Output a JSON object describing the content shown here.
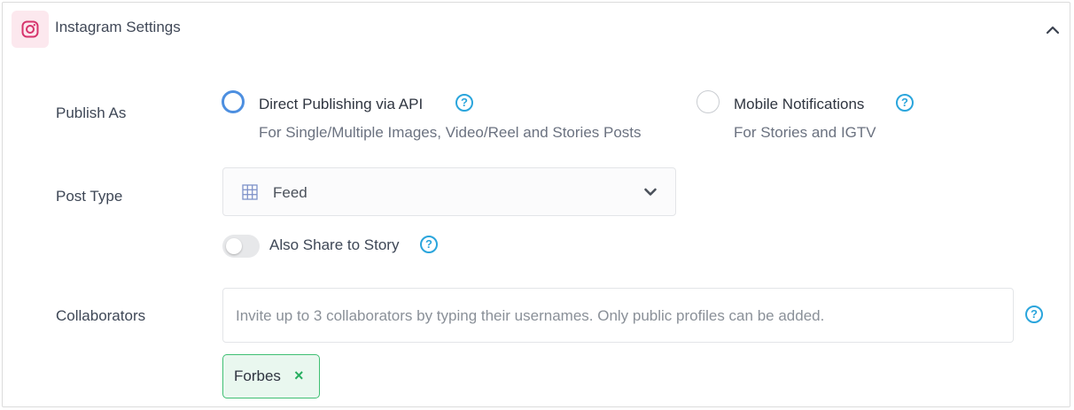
{
  "header": {
    "title": "Instagram Settings",
    "icon": "instagram-icon",
    "collapse_icon": "chevron-up-icon"
  },
  "publish_as": {
    "label": "Publish As",
    "options": [
      {
        "title": "Direct Publishing via API",
        "description": "For Single/Multiple Images, Video/Reel and Stories Posts",
        "selected": true
      },
      {
        "title": "Mobile Notifications",
        "description": "For Stories and IGTV",
        "selected": false
      }
    ]
  },
  "post_type": {
    "label": "Post Type",
    "selected": "Feed",
    "icon": "grid-icon"
  },
  "story_toggle": {
    "label": "Also Share to Story",
    "enabled": false
  },
  "collaborators": {
    "label": "Collaborators",
    "placeholder": "Invite up to 3 collaborators by typing their usernames. Only public profiles can be added.",
    "value": "",
    "tags": [
      "Forbes"
    ]
  },
  "help_glyph": "?",
  "remove_glyph": "×",
  "colors": {
    "accent_blue": "#4d8fe0",
    "help_blue": "#2aa5dc",
    "instagram_pink": "#d6336c",
    "tag_green": "#3fbf73"
  }
}
